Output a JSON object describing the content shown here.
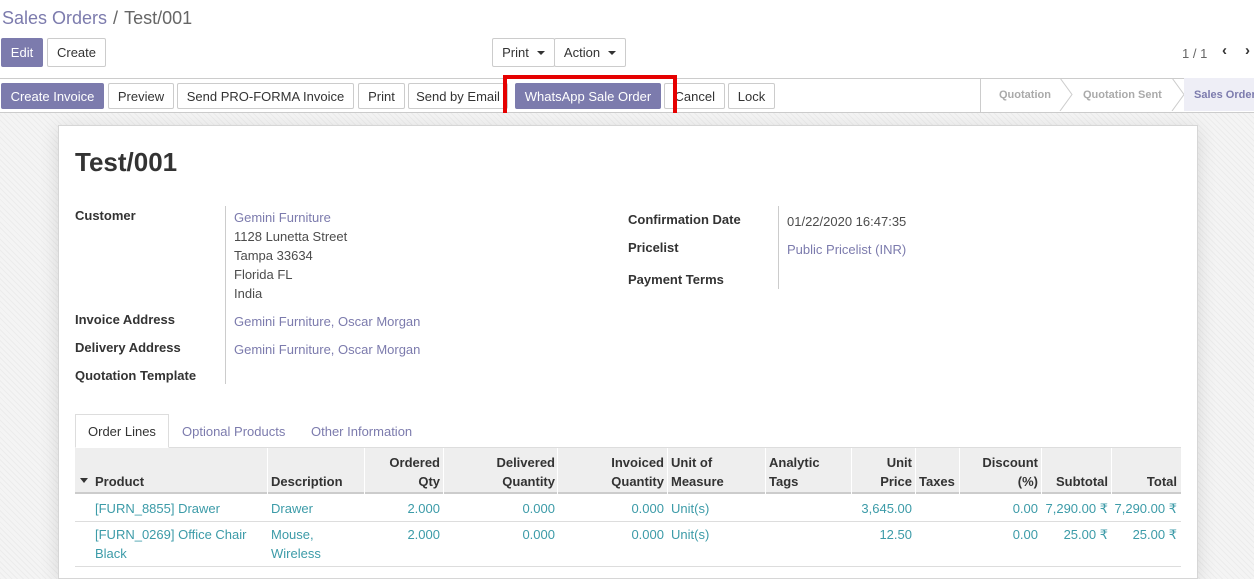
{
  "breadcrumb": {
    "parent": "Sales Orders",
    "separator": "/",
    "current": "Test/001"
  },
  "toolbar": {
    "edit_label": "Edit",
    "create_label": "Create",
    "print_label": "Print",
    "action_label": "Action",
    "pager": "1 / 1",
    "prev_icon": "‹",
    "next_icon": "›"
  },
  "statusbar": {
    "buttons": {
      "create_invoice": "Create Invoice",
      "preview": "Preview",
      "send_proforma": "Send PRO-FORMA Invoice",
      "print": "Print",
      "send_email": "Send by Email",
      "whatsapp": "WhatsApp Sale Order",
      "cancel": "Cancel",
      "lock": "Lock"
    },
    "states": [
      "Quotation",
      "Quotation Sent",
      "Sales Order"
    ],
    "active_state": "Sales Order"
  },
  "record": {
    "name": "Test/001",
    "customer_label": "Customer",
    "customer_name": "Gemini Furniture",
    "customer_address": [
      "1128 Lunetta Street",
      "Tampa 33634",
      "Florida FL",
      "India"
    ],
    "invoice_address_label": "Invoice Address",
    "invoice_address": "Gemini Furniture, Oscar Morgan",
    "delivery_address_label": "Delivery Address",
    "delivery_address": "Gemini Furniture, Oscar Morgan",
    "quotation_template_label": "Quotation Template",
    "confirmation_date_label": "Confirmation Date",
    "confirmation_date": "01/22/2020 16:47:35",
    "pricelist_label": "Pricelist",
    "pricelist": "Public Pricelist (INR)",
    "payment_terms_label": "Payment Terms"
  },
  "tabs": [
    "Order Lines",
    "Optional Products",
    "Other Information"
  ],
  "table": {
    "headers": {
      "product": "Product",
      "description": "Description",
      "ordered_qty": [
        "Ordered",
        "Qty"
      ],
      "delivered_qty": [
        "Delivered",
        "Quantity"
      ],
      "invoiced_qty": [
        "Invoiced",
        "Quantity"
      ],
      "uom": [
        "Unit of",
        "Measure"
      ],
      "analytic_tags": [
        "Analytic",
        "Tags"
      ],
      "unit_price": [
        "Unit",
        "Price"
      ],
      "taxes": "Taxes",
      "discount": [
        "Discount",
        "(%)"
      ],
      "subtotal": "Subtotal",
      "total": "Total"
    },
    "rows": [
      {
        "product": [
          "[FURN_8855] Drawer"
        ],
        "description": [
          "Drawer"
        ],
        "ordered_qty": "2.000",
        "delivered_qty": "0.000",
        "invoiced_qty": "0.000",
        "uom": "Unit(s)",
        "unit_price": "3,645.00",
        "discount": "0.00",
        "subtotal": "7,290.00 ₹",
        "total": "7,290.00 ₹"
      },
      {
        "product": [
          "[FURN_0269] Office Chair",
          "Black"
        ],
        "description": [
          "Mouse,",
          "Wireless"
        ],
        "ordered_qty": "2.000",
        "delivered_qty": "0.000",
        "invoiced_qty": "0.000",
        "uom": "Unit(s)",
        "unit_price": "12.50",
        "discount": "0.00",
        "subtotal": "25.00 ₹",
        "total": "25.00 ₹"
      }
    ]
  },
  "colors": {
    "brand": "#7c7bad",
    "link": "#3c9ba8",
    "highlight": "#e50000"
  }
}
